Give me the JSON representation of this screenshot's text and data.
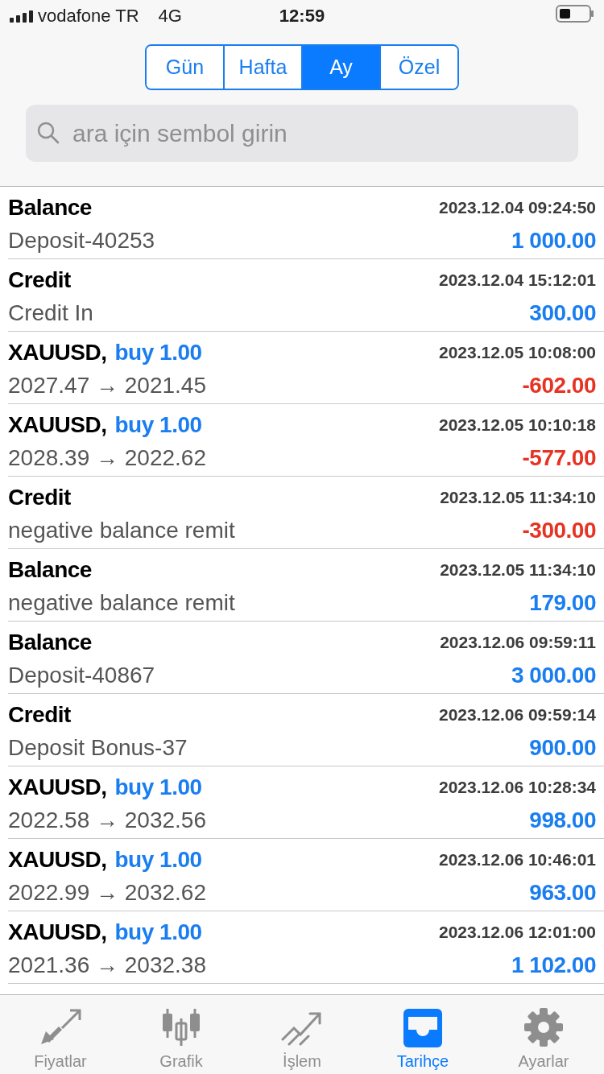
{
  "status_bar": {
    "carrier": "vodafone TR",
    "network": "4G",
    "time": "12:59"
  },
  "period_tabs": [
    {
      "label": "Gün",
      "selected": false
    },
    {
      "label": "Hafta",
      "selected": false
    },
    {
      "label": "Ay",
      "selected": true
    },
    {
      "label": "Özel",
      "selected": false
    }
  ],
  "search": {
    "placeholder": "ara için sembol girin"
  },
  "history": [
    {
      "title": "Balance",
      "datetime": "2023.12.04 09:24:50",
      "detail": "Deposit-40253",
      "amount": "1 000.00",
      "negative": false
    },
    {
      "title": "Credit",
      "datetime": "2023.12.04 15:12:01",
      "detail": "Credit In",
      "amount": "300.00",
      "negative": false
    },
    {
      "title": "XAUUSD,",
      "order": "buy 1.00",
      "datetime": "2023.12.05 10:08:00",
      "detail": "2027.47 → 2021.45",
      "amount": "-602.00",
      "negative": true
    },
    {
      "title": "XAUUSD,",
      "order": "buy 1.00",
      "datetime": "2023.12.05 10:10:18",
      "detail": "2028.39 → 2022.62",
      "amount": "-577.00",
      "negative": true
    },
    {
      "title": "Credit",
      "datetime": "2023.12.05 11:34:10",
      "detail": "negative balance remit",
      "amount": "-300.00",
      "negative": true
    },
    {
      "title": "Balance",
      "datetime": "2023.12.05 11:34:10",
      "detail": "negative balance remit",
      "amount": "179.00",
      "negative": false
    },
    {
      "title": "Balance",
      "datetime": "2023.12.06 09:59:11",
      "detail": "Deposit-40867",
      "amount": "3 000.00",
      "negative": false
    },
    {
      "title": "Credit",
      "datetime": "2023.12.06 09:59:14",
      "detail": "Deposit Bonus-37",
      "amount": "900.00",
      "negative": false
    },
    {
      "title": "XAUUSD,",
      "order": "buy 1.00",
      "datetime": "2023.12.06 10:28:34",
      "detail": "2022.58 → 2032.56",
      "amount": "998.00",
      "negative": false
    },
    {
      "title": "XAUUSD,",
      "order": "buy 1.00",
      "datetime": "2023.12.06 10:46:01",
      "detail": "2022.99 → 2032.62",
      "amount": "963.00",
      "negative": false
    },
    {
      "title": "XAUUSD,",
      "order": "buy 1.00",
      "datetime": "2023.12.06 12:01:00",
      "detail": "2021.36 → 2032.38",
      "amount": "1 102.00",
      "negative": false
    }
  ],
  "tab_bar": [
    {
      "label": "Fiyatlar",
      "selected": false
    },
    {
      "label": "Grafik",
      "selected": false
    },
    {
      "label": "İşlem",
      "selected": false
    },
    {
      "label": "Tarihçe",
      "selected": true
    },
    {
      "label": "Ayarlar",
      "selected": false
    }
  ]
}
